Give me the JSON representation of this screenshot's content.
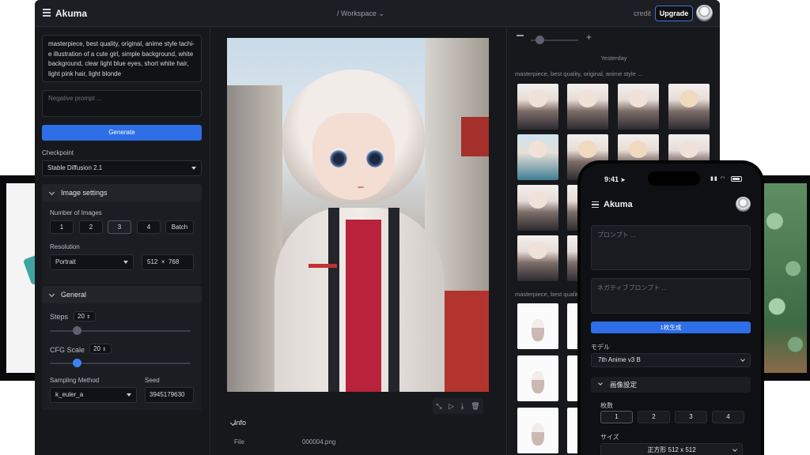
{
  "app": {
    "title": "Akuma",
    "workspace": "/ Workspace",
    "credit_label": "credit",
    "upgrade_label": "Upgrade"
  },
  "left": {
    "prompt": "masterpiece, best quality, original, anime style tachi-e illustration of a cute girl, simple background, white background, clear light blue eyes, short white hair, light pink hair, light blonde",
    "negative_placeholder": "Negative prompt ...",
    "generate_label": "Generate",
    "checkpoint_label": "Checkpoint",
    "checkpoint_value": "Stable Diffusion 2.1",
    "image_settings_label": "Image settings",
    "num_images_label": "Number of Images",
    "num_options": [
      "1",
      "2",
      "3",
      "4",
      "Batch"
    ],
    "num_selected": "3",
    "resolution_label": "Resolution",
    "resolution_value": "Portrait",
    "width": "512",
    "times": "×",
    "height": "768",
    "general_label": "General",
    "steps_label": "Steps",
    "steps_value": "20",
    "steps_fraction": 0.19,
    "cfg_label": "CFG Scale",
    "cfg_value": "20",
    "cfg_fraction": 0.19,
    "sampling_label": "Sampling Method",
    "sampling_value": "k_euler_a",
    "seed_label": "Seed",
    "seed_value": "3945179630"
  },
  "center": {
    "info_label": "Info",
    "file_label": "File",
    "file_value": "000004.png"
  },
  "history": {
    "date_label": "Yesterday",
    "prompt_preview": "masterpiece, best quality, original, anime style ..."
  },
  "phone": {
    "time": "9:41",
    "title": "Akuma",
    "prompt_placeholder": "プロンプト ...",
    "negative_placeholder": "ネガティブプロンプト ...",
    "generate_label": "1枚生成",
    "model_label": "モデル",
    "model_value": "7th Anime v3 B",
    "image_settings_label": "画像設定",
    "count_label": "枚数",
    "count_options": [
      "1",
      "2",
      "3",
      "4"
    ],
    "count_selected": "1",
    "size_label": "サイズ",
    "size_value": "正方形 512 x 512"
  },
  "colors": {
    "accent": "#2e6ee6",
    "slider_blue": "#3b82f6",
    "background": "#17181c"
  }
}
